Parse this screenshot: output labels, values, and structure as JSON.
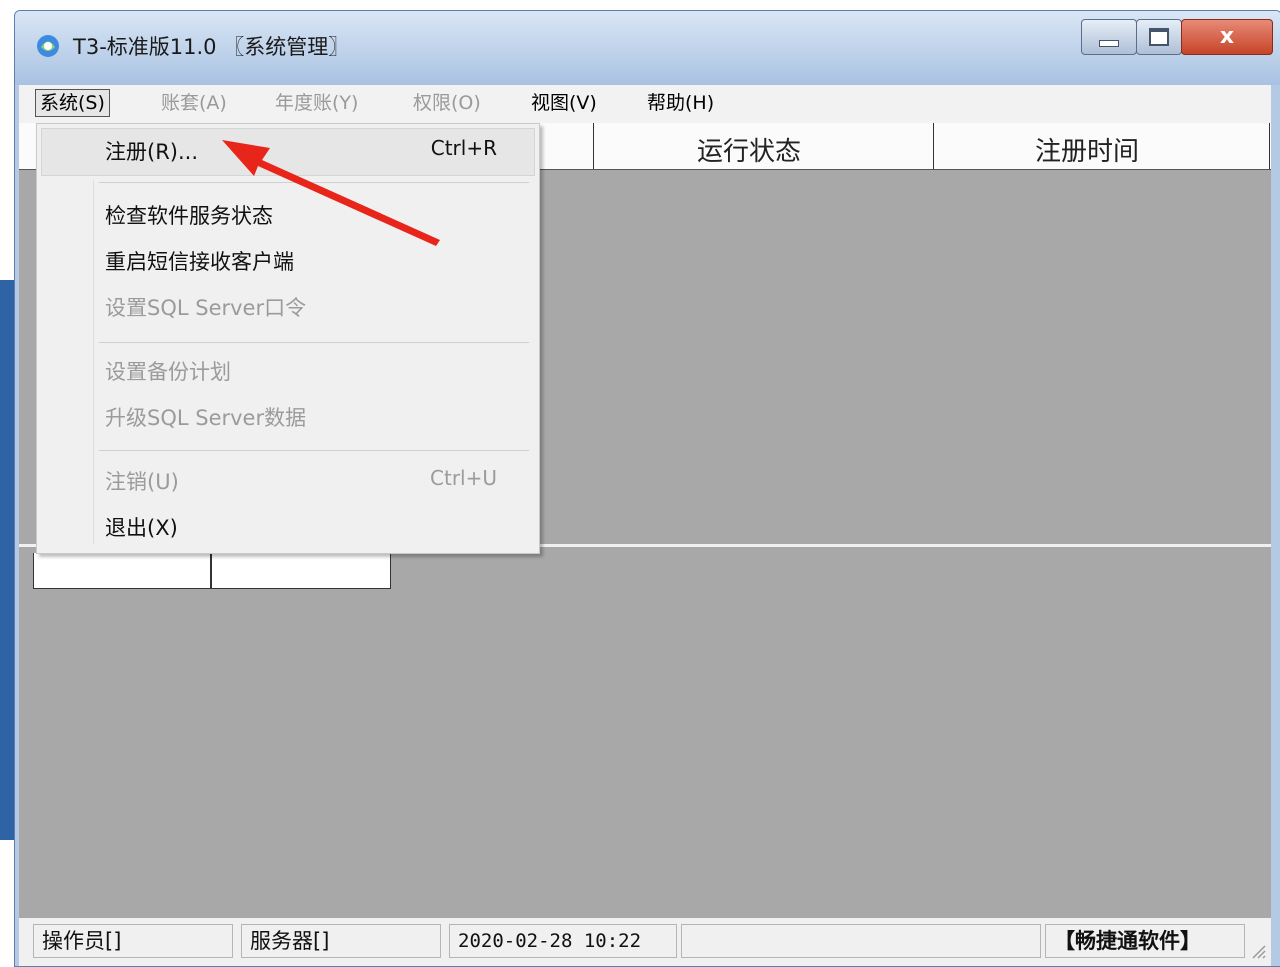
{
  "window": {
    "title": "T3-标准版11.0 〖系统管理〗",
    "controls": {
      "minimize": "minimize",
      "maximize": "maximize",
      "close": "x"
    }
  },
  "menubar": {
    "items": [
      {
        "label": "系统(S)",
        "enabled": true,
        "open": true
      },
      {
        "label": "账套(A)",
        "enabled": false
      },
      {
        "label": "年度账(Y)",
        "enabled": false
      },
      {
        "label": "权限(O)",
        "enabled": false
      },
      {
        "label": "视图(V)",
        "enabled": true
      },
      {
        "label": "帮助(H)",
        "enabled": true
      }
    ]
  },
  "table": {
    "headers": [
      "运行状态",
      "注册时间"
    ]
  },
  "system_menu": {
    "items": [
      {
        "label": "注册(R)...",
        "shortcut": "Ctrl+R",
        "enabled": true,
        "highlighted": true
      },
      {
        "label": "检查软件服务状态",
        "enabled": true
      },
      {
        "label": "重启短信接收客户端",
        "enabled": true
      },
      {
        "label": "设置SQL Server口令",
        "enabled": false
      },
      {
        "label": "设置备份计划",
        "enabled": false
      },
      {
        "label": "升级SQL Server数据",
        "enabled": false
      },
      {
        "label": "注销(U)",
        "shortcut": "Ctrl+U",
        "enabled": false
      },
      {
        "label": "退出(X)",
        "enabled": true
      }
    ]
  },
  "statusbar": {
    "operator": "操作员[]",
    "server": "服务器[]",
    "datetime": "2020-02-28 10:22",
    "blank": "",
    "vendor": "【畅捷通软件】"
  },
  "colors": {
    "annotation_arrow": "#e8251b",
    "workspace": "#a8a8a8",
    "titlebar": "#b4c9e3"
  }
}
